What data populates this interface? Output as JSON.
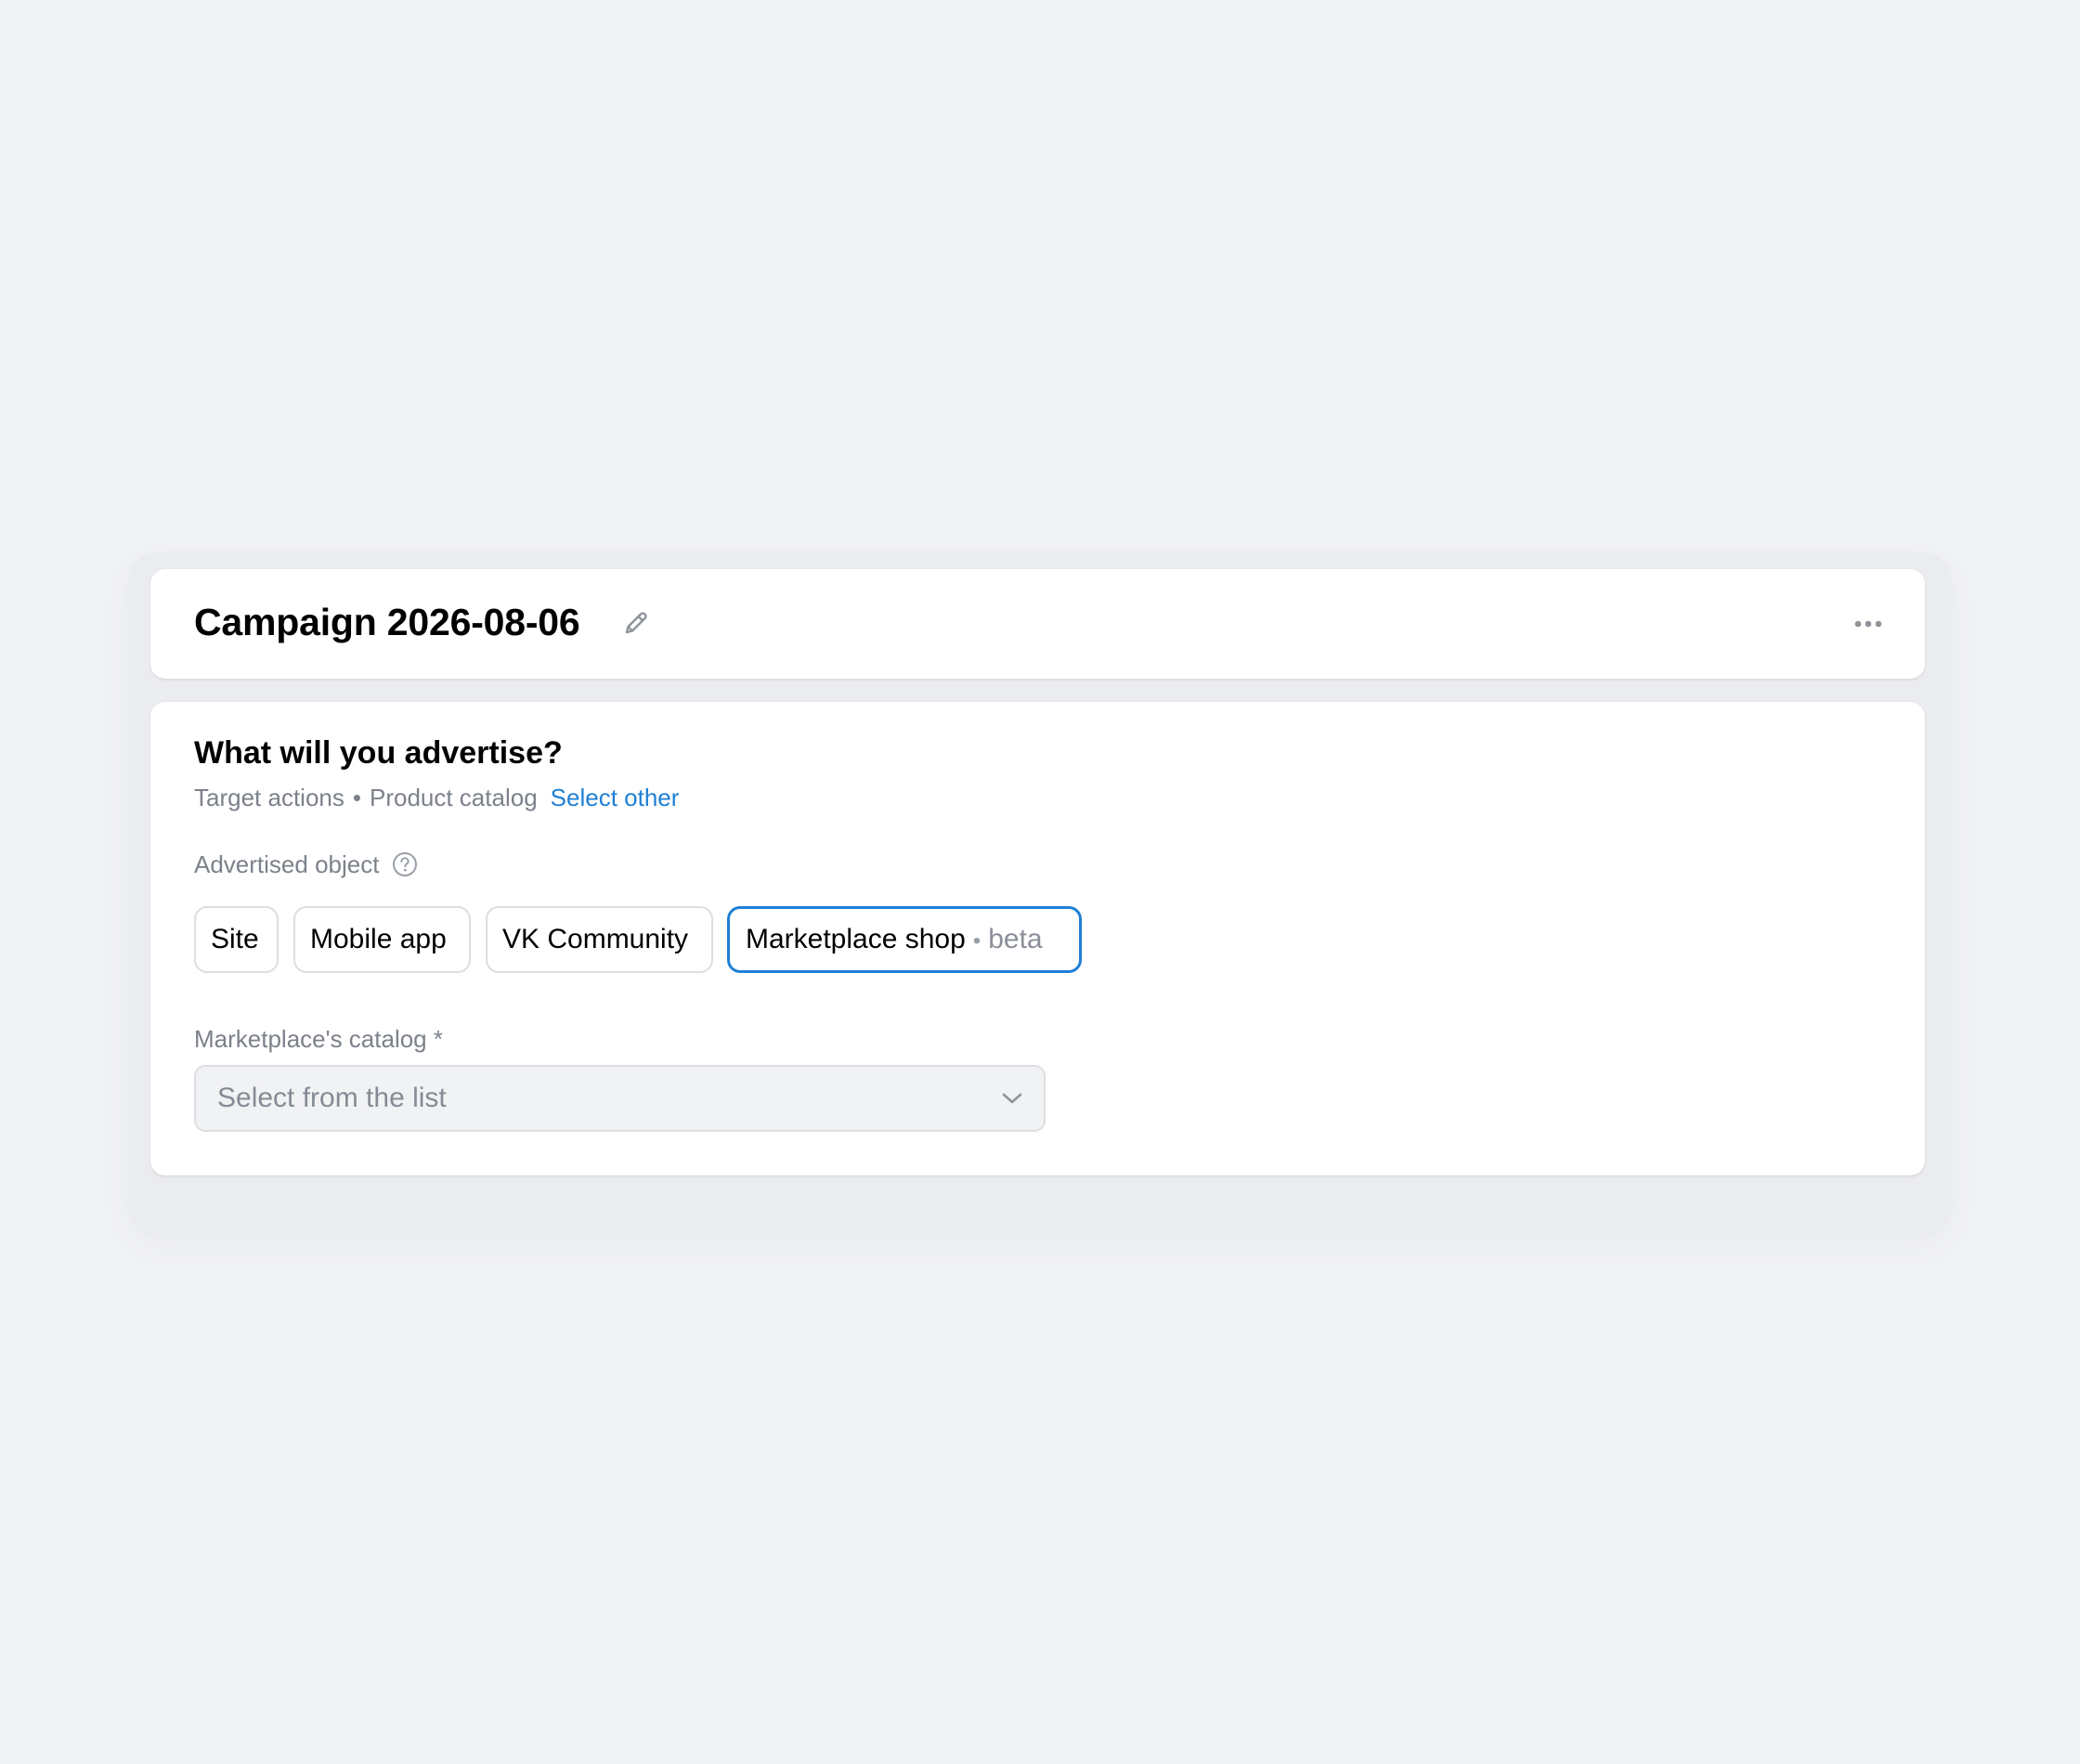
{
  "header": {
    "title": "Campaign 2026-08-06",
    "edit_icon": "pencil-icon",
    "more_icon": "more-horizontal-icon"
  },
  "advertise_section": {
    "title": "What will you advertise?",
    "subtitle_parts": [
      "Target actions",
      "•",
      "Product catalog"
    ],
    "select_other_link": "Select other",
    "advertised_object_label": "Advertised object",
    "help_icon": "question-circle-icon",
    "options": [
      {
        "label": "Site",
        "selected": false
      },
      {
        "label": "Mobile app",
        "selected": false
      },
      {
        "label": "VK Community",
        "selected": false
      },
      {
        "label": "Marketplace shop",
        "badge_separator": "•",
        "badge": "beta",
        "selected": true
      }
    ],
    "catalog_field": {
      "label": "Marketplace's catalog *",
      "placeholder": "Select from the list",
      "icon": "chevron-down-icon"
    }
  },
  "colors": {
    "background": "#f1f2f4",
    "card": "#ffffff",
    "accent": "#1f7fd5",
    "secondary_text": "#7c818a"
  }
}
